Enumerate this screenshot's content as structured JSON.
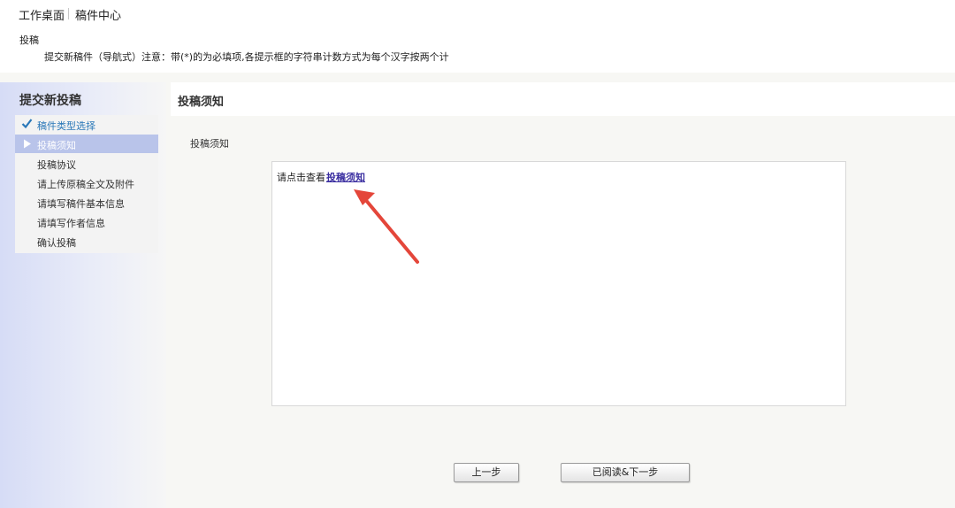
{
  "topbar": {
    "home": "工作桌面",
    "center": "稿件中心"
  },
  "notice": {
    "title": "投稿",
    "description": "提交新稿件（导航式）注意：带(*)的为必填项,各提示框的字符串计数方式为每个汉字按两个计"
  },
  "sidebar": {
    "heading": "提交新投稿",
    "steps": [
      {
        "label": "稿件类型选择",
        "state": "done"
      },
      {
        "label": "投稿须知",
        "state": "current"
      },
      {
        "label": "投稿协议",
        "state": "pending"
      },
      {
        "label": "请上传原稿全文及附件",
        "state": "pending"
      },
      {
        "label": "请填写稿件基本信息",
        "state": "pending"
      },
      {
        "label": "请填写作者信息",
        "state": "pending"
      },
      {
        "label": "确认投稿",
        "state": "pending"
      }
    ]
  },
  "main": {
    "header": "投稿须知",
    "section_title": "投稿须知",
    "prompt": "请点击查看",
    "link": "投稿须知"
  },
  "buttons": {
    "prev": "上一步",
    "next": "已阅读&下一步"
  },
  "colors": {
    "link": "#3a2ea0",
    "arrow": "#e4463a",
    "active_step": "#b9c4ea",
    "done_step": "#2a78b8"
  },
  "icons": {
    "done": "checkmark-icon",
    "current": "triangle-right-icon",
    "annotation": "red-arrow"
  }
}
